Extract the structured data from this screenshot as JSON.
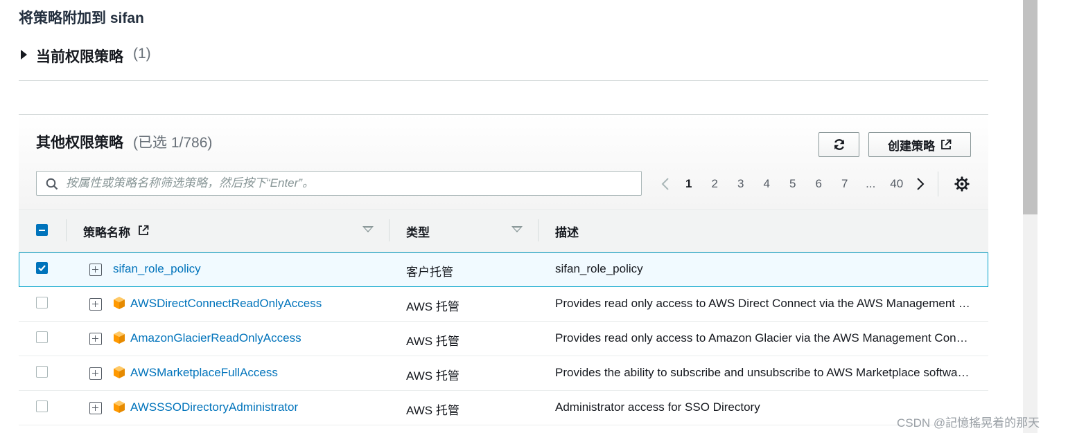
{
  "page_title": "将策略附加到 sifan",
  "current_policies": {
    "title": "当前权限策略",
    "count": "(1)"
  },
  "other_policies": {
    "title": "其他权限策略",
    "count": "(已选 1/786)",
    "refresh_icon": "refresh-icon",
    "create_label": "创建策略"
  },
  "search": {
    "placeholder": "按属性或策略名称筛选策略，然后按下“Enter”。",
    "value": ""
  },
  "pagination": {
    "pages": [
      "1",
      "2",
      "3",
      "4",
      "5",
      "6",
      "7",
      "...",
      "40"
    ],
    "current": "1"
  },
  "table": {
    "columns": {
      "name": "策略名称",
      "type": "类型",
      "description": "描述"
    },
    "rows": [
      {
        "checked": true,
        "aws_managed": false,
        "name": "sifan_role_policy",
        "type": "客户托管",
        "description": "sifan_role_policy"
      },
      {
        "checked": false,
        "aws_managed": true,
        "name": "AWSDirectConnectReadOnlyAccess",
        "type": "AWS 托管",
        "description": "Provides read only access to AWS Direct Connect via the AWS Management Console."
      },
      {
        "checked": false,
        "aws_managed": true,
        "name": "AmazonGlacierReadOnlyAccess",
        "type": "AWS 托管",
        "description": "Provides read only access to Amazon Glacier via the AWS Management Console."
      },
      {
        "checked": false,
        "aws_managed": true,
        "name": "AWSMarketplaceFullAccess",
        "type": "AWS 托管",
        "description": "Provides the ability to subscribe and unsubscribe to AWS Marketplace software."
      },
      {
        "checked": false,
        "aws_managed": true,
        "name": "AWSSSODirectoryAdministrator",
        "type": "AWS 托管",
        "description": "Administrator access for SSO Directory"
      }
    ]
  },
  "watermark": "CSDN @記憶搖晃着的那天",
  "colors": {
    "link": "#0073bb",
    "accent": "#0073bb",
    "aws_orange": "#ff9900"
  }
}
